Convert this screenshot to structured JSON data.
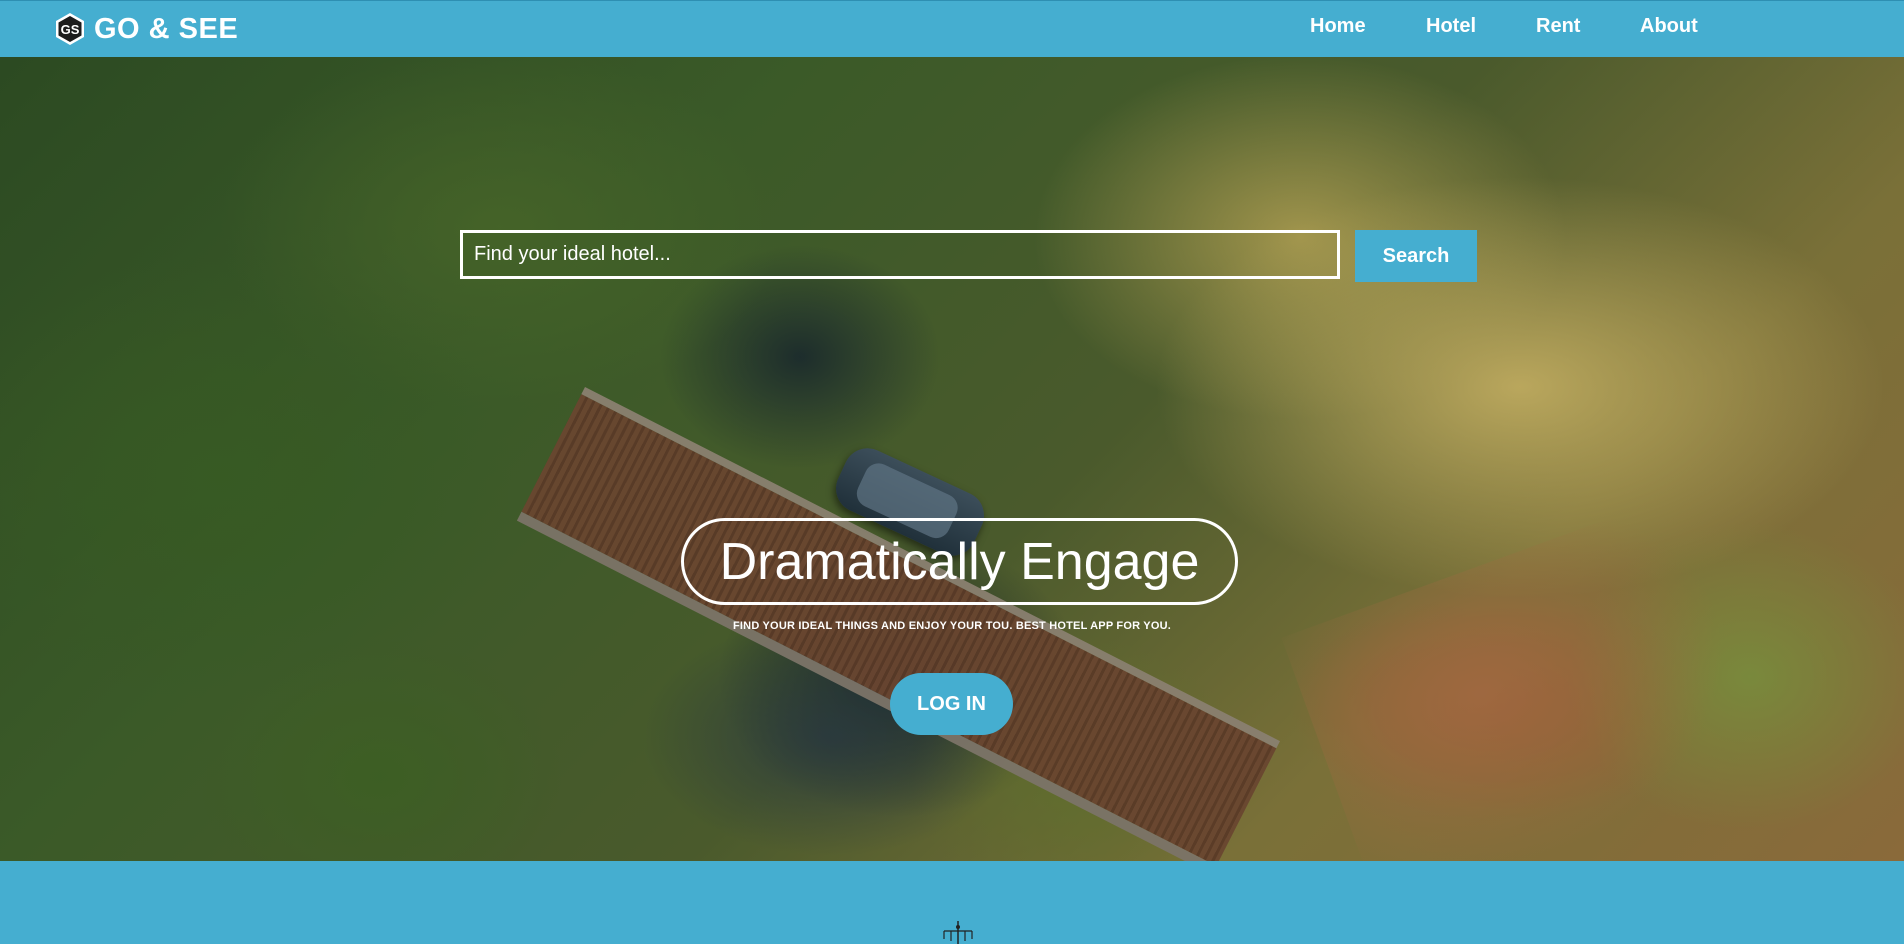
{
  "brand": {
    "name": "GO & SEE",
    "logo_icon": "gs-hexagon-logo-icon"
  },
  "nav": {
    "items": [
      {
        "label": "Home"
      },
      {
        "label": "Hotel"
      },
      {
        "label": "Rent"
      },
      {
        "label": "About"
      }
    ]
  },
  "search": {
    "placeholder": "Find your ideal hotel...",
    "value": "",
    "button_label": "Search"
  },
  "hero": {
    "headline": "Dramatically Engage",
    "tagline": "FIND YOUR IDEAL THINGS AND ENJOY YOUR TOU. BEST HOTEL APP FOR YOU.",
    "login_label": "LOG IN",
    "background_description_icon": "forest-bridge-car-photo"
  },
  "footer": {
    "decor_icon": "chandelier-icon"
  },
  "colors": {
    "accent": "#45aed0",
    "text_on_accent": "#ffffff"
  }
}
